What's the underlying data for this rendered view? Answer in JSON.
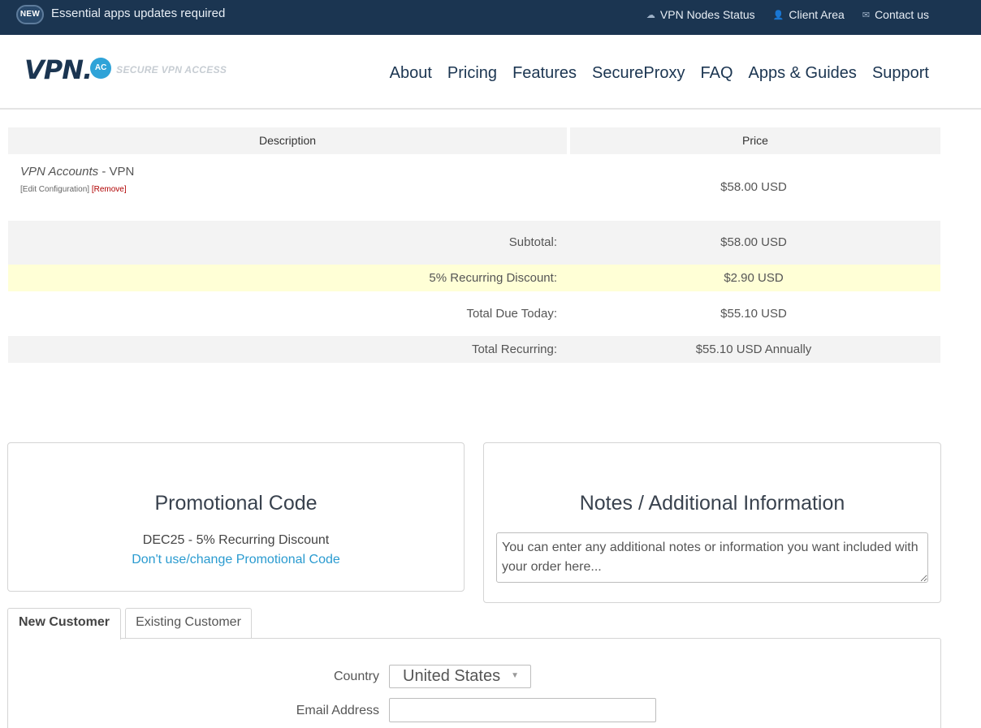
{
  "topbar": {
    "badge": "NEW",
    "announcement": "Essential apps updates required",
    "links": [
      {
        "label": "VPN Nodes Status",
        "icon": "cloud-icon"
      },
      {
        "label": "Client Area",
        "icon": "user-icon"
      },
      {
        "label": "Contact us",
        "icon": "envelope-icon"
      }
    ]
  },
  "header": {
    "logo_text": "VPN.",
    "logo_badge": "AC",
    "logo_tagline": "SECURE VPN ACCESS",
    "nav": [
      "About",
      "Pricing",
      "Features",
      "SecureProxy",
      "FAQ",
      "Apps & Guides",
      "Support"
    ]
  },
  "order": {
    "col_description": "Description",
    "col_price": "Price",
    "item": {
      "product": "VPN Accounts",
      "separator": " - ",
      "plan": "VPN",
      "edit_label": "[Edit Configuration]",
      "remove_label": "[Remove]",
      "price": "$58.00 USD"
    },
    "subtotal_label": "Subtotal:",
    "subtotal_value": "$58.00 USD",
    "discount_label": "5% Recurring Discount:",
    "discount_value": "$2.90 USD",
    "due_label": "Total Due Today:",
    "due_value": "$55.10 USD",
    "recurring_label": "Total Recurring:",
    "recurring_value": "$55.10 USD Annually"
  },
  "promo": {
    "title": "Promotional Code",
    "applied": "DEC25 - 5% Recurring Discount",
    "change_link": "Don't use/change Promotional Code"
  },
  "notes": {
    "title": "Notes / Additional Information",
    "placeholder": "You can enter any additional notes or information you want included with your order here..."
  },
  "tabs": {
    "new_customer": "New Customer",
    "existing_customer": "Existing Customer"
  },
  "form": {
    "country_label": "Country",
    "country_value": "United States",
    "email_label": "Email Address",
    "email_value": ""
  }
}
